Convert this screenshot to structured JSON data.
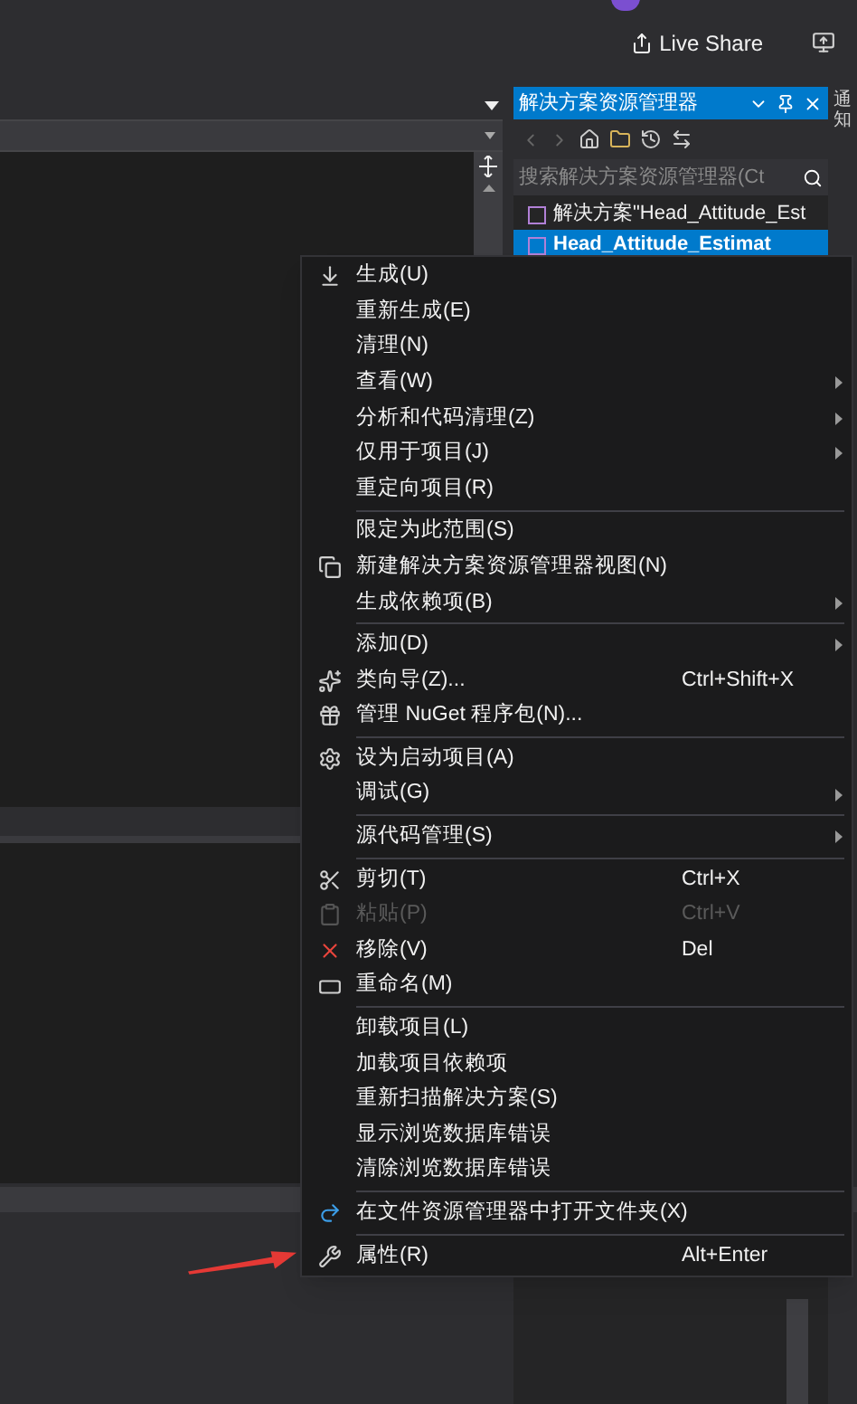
{
  "top_bar": {
    "live_share": "Live Share"
  },
  "solution_explorer": {
    "title": "解决方案资源管理器",
    "search": {
      "placeholder": "搜索解决方案资源管理器(Ct"
    },
    "tree": [
      {
        "label": "解决方案\"Head_Attitude_Est",
        "selected": false
      },
      {
        "label": "Head_Attitude_Estimat",
        "selected": true
      }
    ]
  },
  "side_tab": "通知",
  "context_menu": [
    {
      "kind": "item",
      "label": "生成(U)",
      "has_submenu": false,
      "disabled": false
    },
    {
      "kind": "item",
      "label": "重新生成(E)",
      "has_submenu": false,
      "disabled": false
    },
    {
      "kind": "item",
      "label": "清理(N)",
      "has_submenu": false,
      "disabled": false
    },
    {
      "kind": "item",
      "label": "查看(W)",
      "has_submenu": true,
      "disabled": false
    },
    {
      "kind": "item",
      "label": "分析和代码清理(Z)",
      "has_submenu": true,
      "disabled": false
    },
    {
      "kind": "item",
      "label": "仅用于项目(J)",
      "has_submenu": true,
      "disabled": false
    },
    {
      "kind": "item",
      "label": "重定向项目(R)",
      "has_submenu": false,
      "disabled": false
    },
    {
      "kind": "separator"
    },
    {
      "kind": "item",
      "label": "限定为此范围(S)",
      "has_submenu": false,
      "disabled": false
    },
    {
      "kind": "item",
      "label": "新建解决方案资源管理器视图(N)",
      "has_submenu": false,
      "disabled": false
    },
    {
      "kind": "item",
      "label": "生成依赖项(B)",
      "has_submenu": true,
      "disabled": false
    },
    {
      "kind": "separator"
    },
    {
      "kind": "item",
      "label": "添加(D)",
      "has_submenu": true,
      "disabled": false
    },
    {
      "kind": "item",
      "label": "类向导(Z)...",
      "shortcut": "Ctrl+Shift+X",
      "has_submenu": false,
      "disabled": false
    },
    {
      "kind": "item",
      "label": "管理 NuGet 程序包(N)...",
      "has_submenu": false,
      "disabled": false
    },
    {
      "kind": "separator"
    },
    {
      "kind": "item",
      "label": "设为启动项目(A)",
      "has_submenu": false,
      "disabled": false
    },
    {
      "kind": "item",
      "label": "调试(G)",
      "has_submenu": true,
      "disabled": false
    },
    {
      "kind": "separator"
    },
    {
      "kind": "item",
      "label": "源代码管理(S)",
      "has_submenu": true,
      "disabled": false
    },
    {
      "kind": "separator"
    },
    {
      "kind": "item",
      "label": "剪切(T)",
      "shortcut": "Ctrl+X",
      "has_submenu": false,
      "disabled": false
    },
    {
      "kind": "item",
      "label": "粘贴(P)",
      "shortcut": "Ctrl+V",
      "has_submenu": false,
      "disabled": true
    },
    {
      "kind": "item",
      "label": "移除(V)",
      "shortcut": "Del",
      "has_submenu": false,
      "disabled": false
    },
    {
      "kind": "item",
      "label": "重命名(M)",
      "has_submenu": false,
      "disabled": false
    },
    {
      "kind": "separator"
    },
    {
      "kind": "item",
      "label": "卸载项目(L)",
      "has_submenu": false,
      "disabled": false
    },
    {
      "kind": "item",
      "label": "加载项目依赖项",
      "has_submenu": false,
      "disabled": false
    },
    {
      "kind": "item",
      "label": "重新扫描解决方案(S)",
      "has_submenu": false,
      "disabled": false
    },
    {
      "kind": "item",
      "label": "显示浏览数据库错误",
      "has_submenu": false,
      "disabled": false
    },
    {
      "kind": "item",
      "label": "清除浏览数据库错误",
      "has_submenu": false,
      "disabled": false
    },
    {
      "kind": "separator"
    },
    {
      "kind": "item",
      "label": "在文件资源管理器中打开文件夹(X)",
      "has_submenu": false,
      "disabled": false
    },
    {
      "kind": "separator"
    },
    {
      "kind": "item",
      "label": "属性(R)",
      "shortcut": "Alt+Enter",
      "has_submenu": false,
      "disabled": false
    }
  ]
}
